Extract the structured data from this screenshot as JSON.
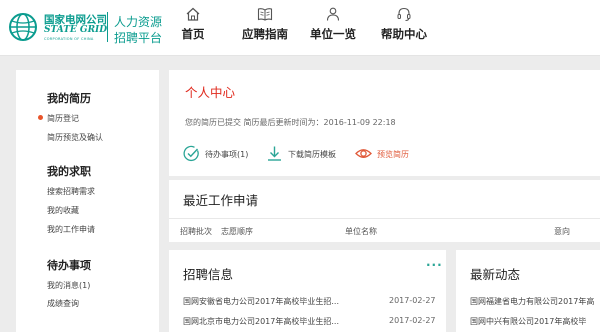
{
  "header": {
    "logo": {
      "cn": "国家电网公司",
      "en": "STATE GRID",
      "sub": "CORPORATION OF CHINA",
      "portal_line1": "人力资源",
      "portal_line2": "招聘平台"
    },
    "nav": [
      {
        "label": "首页",
        "icon": "home-icon"
      },
      {
        "label": "应聘指南",
        "icon": "book-icon"
      },
      {
        "label": "单位一览",
        "icon": "people-icon"
      },
      {
        "label": "帮助中心",
        "icon": "headset-icon"
      }
    ]
  },
  "sidebar": {
    "sections": [
      {
        "title": "我的简历",
        "items": [
          "简历登记",
          "简历预览及确认"
        ]
      },
      {
        "title": "我的求职",
        "items": [
          "搜索招聘需求",
          "我的收藏",
          "我的工作申请"
        ]
      },
      {
        "title": "待办事项",
        "items": [
          "我的消息(1)",
          "成绩查询"
        ]
      }
    ]
  },
  "center": {
    "title": "个人中心",
    "status": "您的简历已提交 简历最后更新时间为：2016-11-09 22:18",
    "actions": [
      {
        "label": "待办事项(1)",
        "icon": "check-circle-icon"
      },
      {
        "label": "下载简历模板",
        "icon": "download-icon"
      },
      {
        "label": "预览简历",
        "icon": "eye-icon"
      }
    ]
  },
  "recent": {
    "title": "最近工作申请",
    "columns": [
      "招聘批次",
      "志愿顺序",
      "单位名称",
      "意向"
    ]
  },
  "jobs": {
    "title": "招聘信息",
    "more": "···",
    "items": [
      {
        "title": "国网安徽省电力公司2017年高校毕业生招...",
        "date": "2017-02-27"
      },
      {
        "title": "国网北京市电力公司2017年高校毕业生招...",
        "date": "2017-02-27"
      }
    ]
  },
  "news": {
    "title": "最新动态",
    "items": [
      "国网福建省电力有限公司2017年高",
      "国网中兴有限公司2017年高校毕"
    ]
  },
  "colors": {
    "brand": "#0b9c8f",
    "accent_red": "#e02a1e",
    "preview_orange": "#e05a3a",
    "page_bg": "#ececec"
  }
}
